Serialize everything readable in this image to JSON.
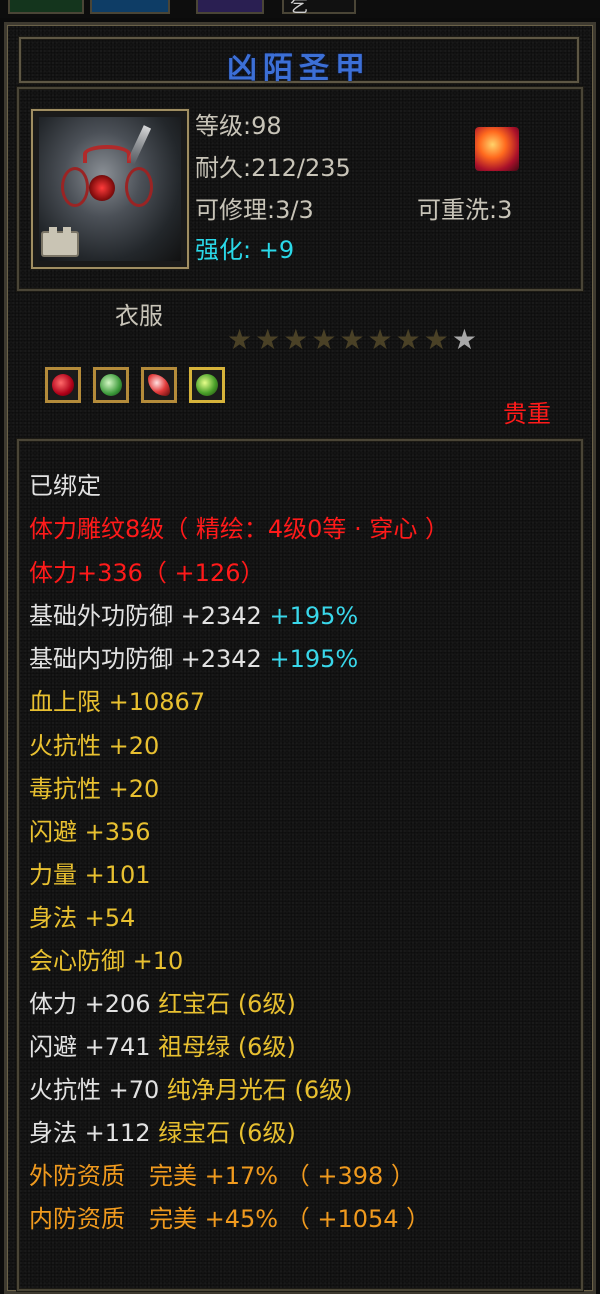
{
  "top_tabs": {
    "tab4_text": "乞"
  },
  "item": {
    "name": "凶陌圣甲",
    "level": "等级:98",
    "durability": "耐久:212/235",
    "repairable": "可修理:3/3",
    "rewashable": "可重洗:3",
    "enhance_label": "强化:",
    "enhance_value": "+9",
    "category": "衣服",
    "stars": {
      "filled": 8,
      "total": 9
    },
    "rarity": "贵重"
  },
  "gems": [
    "ruby-gem-icon",
    "emerald-gem-icon",
    "red-crystal-gem-icon",
    "green-jade-gem-icon"
  ],
  "stats": {
    "bound": "已绑定",
    "engrave": "体力雕纹8级（ 精绘：4级0等 · 穿心 ）",
    "stamina": "体力+336（ +126）",
    "ext_def_label": "基础外功防御 +2342",
    "ext_def_pct": "+195%",
    "int_def_label": "基础内功防御 +2342",
    "int_def_pct": "+195%",
    "hp": "血上限 +10867",
    "fire_res": "火抗性 +20",
    "poison_res": "毒抗性 +20",
    "dodge": "闪避 +356",
    "strength": "力量 +101",
    "agility": "身法 +54",
    "crit_def": "会心防御 +10",
    "gem1_stat": "体力 +206",
    "gem1_name": "红宝石 (6级)",
    "gem2_stat": "闪避 +741",
    "gem2_name": "祖母绿 (6级)",
    "gem3_stat": "火抗性 +70",
    "gem3_name": "纯净月光石 (6级)",
    "gem4_stat": "身法 +112",
    "gem4_name": "绿宝石 (6级)",
    "ext_quality": "外防资质　完美 +17% （ +398 ）",
    "int_quality": "内防资质　完美 +45% （ +1054 ）"
  },
  "colors": {
    "title": "#3c6fd6",
    "cyan": "#2ad8e8",
    "red": "#ff1a1a",
    "yellow": "#e8c030",
    "orange": "#f09a1e",
    "white": "#e2e2e2"
  }
}
